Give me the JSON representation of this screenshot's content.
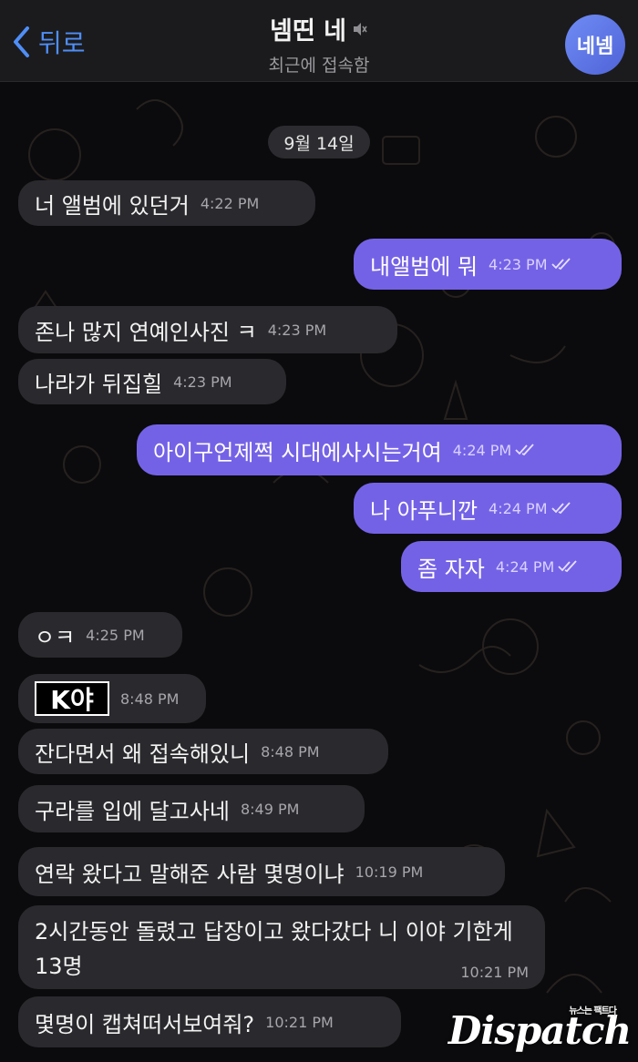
{
  "header": {
    "back_label": "뒤로",
    "title": "넴띤 네",
    "subtitle": "최근에 접속함",
    "avatar_text": "네넴"
  },
  "date_label": "9월 14일",
  "messages": [
    {
      "dir": "in",
      "text": "너 앨범에 있던거",
      "time": "4:22 PM"
    },
    {
      "dir": "out",
      "text": "내앨범에 뭐",
      "time": "4:23 PM"
    },
    {
      "dir": "in",
      "text": "존나 많지 연예인사진 ㅋ",
      "time": "4:23 PM"
    },
    {
      "dir": "in",
      "text": "나라가 뒤집힐",
      "time": "4:23 PM"
    },
    {
      "dir": "out",
      "text": "아이구언제쩍 시대에사시는거여",
      "time": "4:24 PM"
    },
    {
      "dir": "out",
      "text": "나 아푸니깐",
      "time": "4:24 PM"
    },
    {
      "dir": "out",
      "text": "좀 자자",
      "time": "4:24 PM"
    },
    {
      "dir": "in",
      "text": "ㅇㅋ",
      "time": "4:25 PM"
    },
    {
      "dir": "in",
      "text": "K야",
      "time": "8:48 PM"
    },
    {
      "dir": "in",
      "text": "잔다면서 왜 접속해있니",
      "time": "8:48 PM"
    },
    {
      "dir": "in",
      "text": "구라를 입에 달고사네",
      "time": "8:49 PM"
    },
    {
      "dir": "in",
      "text": "연락 왔다고 말해준 사람 몇명이냐",
      "time": "10:19 PM"
    },
    {
      "dir": "in",
      "text": "2시간동안 돌렸고 답장이고 왔다갔다  니 이야 기한게13명",
      "time": "10:21 PM"
    },
    {
      "dir": "in",
      "text": "몇명이 캡쳐떠서보여줘?",
      "time": "10:21 PM"
    }
  ],
  "watermark": {
    "brand": "Dispatch",
    "tagline": "뉴스는 팩트다"
  },
  "colors": {
    "incoming_bubble": "#2a2a2e",
    "outgoing_bubble": "#7462e6",
    "accent": "#4f8ef7"
  },
  "icons": {
    "back": "chevron-left-icon",
    "mute": "mute-icon",
    "read": "double-check-icon"
  }
}
